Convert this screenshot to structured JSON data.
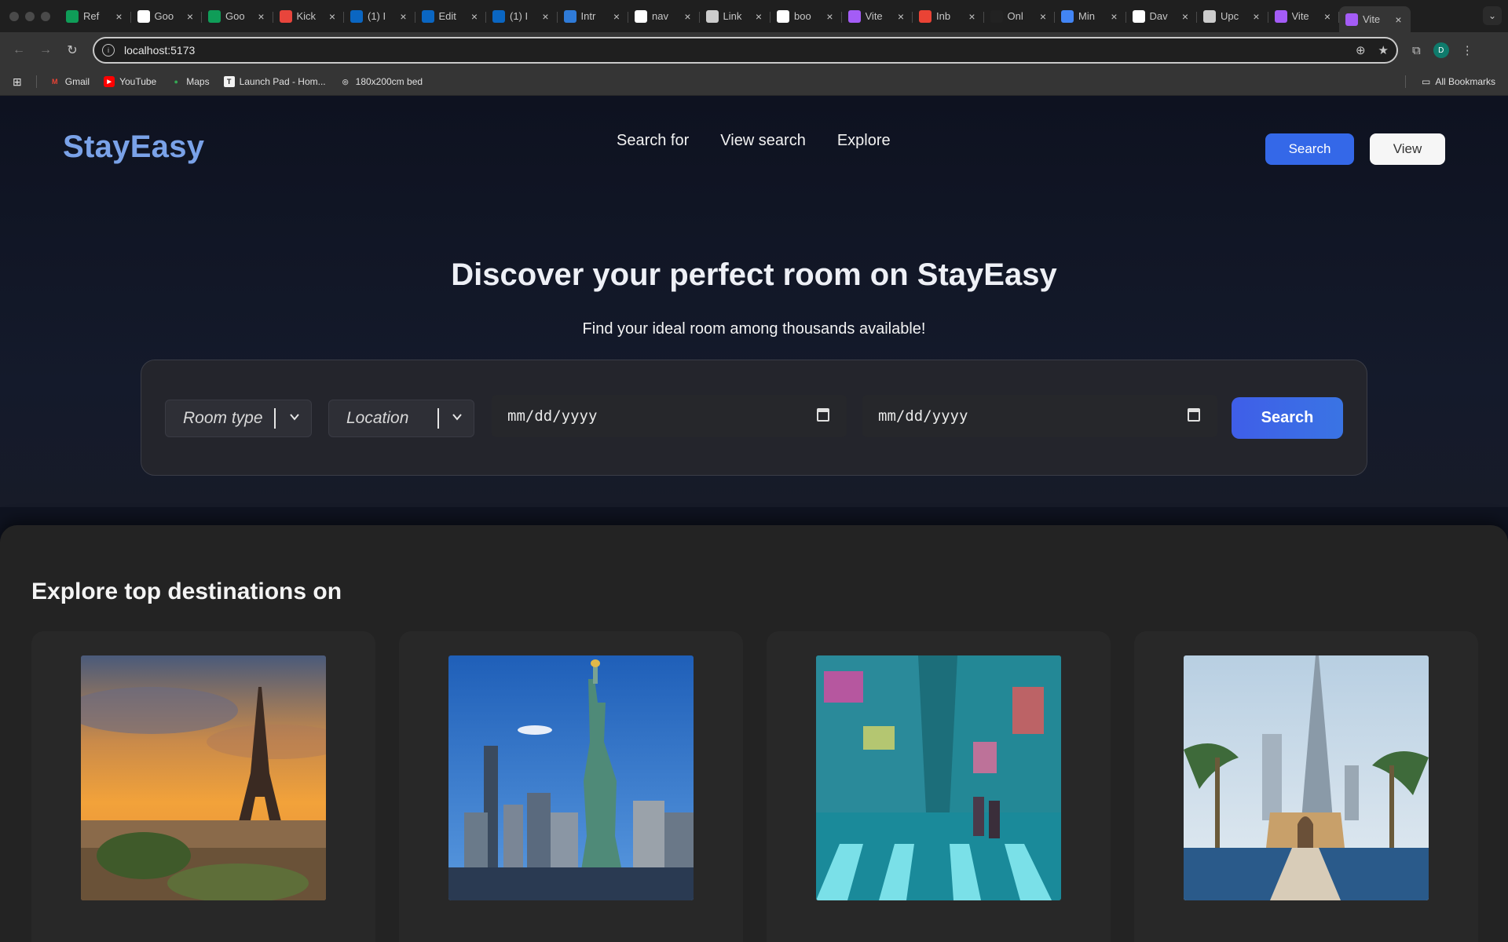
{
  "browser": {
    "tabs": [
      {
        "title": "Ref",
        "icon": "sheets-icon",
        "color": "#0f9d58"
      },
      {
        "title": "Goo",
        "icon": "google-icon",
        "color": "#ffffff"
      },
      {
        "title": "Goo",
        "icon": "sheets-icon",
        "color": "#0f9d58"
      },
      {
        "title": "Kick",
        "icon": "threads-icon",
        "color": "#e8453c"
      },
      {
        "title": "(1) I",
        "icon": "linkedin-icon",
        "color": "#0a66c2"
      },
      {
        "title": "Edit",
        "icon": "linkedin-icon",
        "color": "#0a66c2"
      },
      {
        "title": "(1) I",
        "icon": "linkedin-icon",
        "color": "#0a66c2"
      },
      {
        "title": "Intr",
        "icon": "video-icon",
        "color": "#2f7bd8"
      },
      {
        "title": "nav",
        "icon": "github-icon",
        "color": "#ffffff"
      },
      {
        "title": "Link",
        "icon": "openai-icon",
        "color": "#cccccc"
      },
      {
        "title": "boo",
        "icon": "google-icon",
        "color": "#ffffff"
      },
      {
        "title": "Vite",
        "icon": "vite-icon",
        "color": "#a45cf6"
      },
      {
        "title": "Inb",
        "icon": "gmail-icon",
        "color": "#ea4335"
      },
      {
        "title": "Onl",
        "icon": "doc-icon",
        "color": "#222222"
      },
      {
        "title": "Min",
        "icon": "docs-icon",
        "color": "#4285f4"
      },
      {
        "title": "Dav",
        "icon": "link-icon",
        "color": "#ffffff"
      },
      {
        "title": "Upc",
        "icon": "openai-icon",
        "color": "#cccccc"
      },
      {
        "title": "Vite",
        "icon": "vite-icon",
        "color": "#a45cf6"
      },
      {
        "title": "Vite",
        "icon": "vite-icon",
        "color": "#a45cf6",
        "active": true
      }
    ],
    "url": "localhost:5173",
    "profile_initial": "D",
    "bookmarks": [
      {
        "label": "Gmail",
        "icon": "gmail-icon"
      },
      {
        "label": "YouTube",
        "icon": "youtube-icon"
      },
      {
        "label": "Maps",
        "icon": "maps-icon"
      },
      {
        "label": "Launch Pad - Hom...",
        "icon": "launchpad-icon"
      },
      {
        "label": "180x200cm bed",
        "icon": "globe-icon"
      }
    ],
    "all_bookmarks": "All Bookmarks"
  },
  "site": {
    "brand": "StayEasy",
    "menu": [
      "Search for",
      "View search",
      "Explore"
    ],
    "actions": {
      "primary": "Search",
      "secondary": "View"
    },
    "hero": {
      "title": "Discover your perfect room on StayEasy",
      "subtitle": "Find your ideal room among thousands available!"
    },
    "search": {
      "room_type": "Room type",
      "location": "Location",
      "check_in": "mm/dd/yyyy",
      "check_out": "mm/dd/yyyy",
      "button": "Search"
    },
    "destinations": {
      "title": "Explore top destinations on",
      "cards": [
        {
          "name": "paris-eiffel-tower-image"
        },
        {
          "name": "new-york-statue-of-liberty-image"
        },
        {
          "name": "tokyo-street-image"
        },
        {
          "name": "dubai-burj-khalifa-image"
        }
      ]
    }
  }
}
